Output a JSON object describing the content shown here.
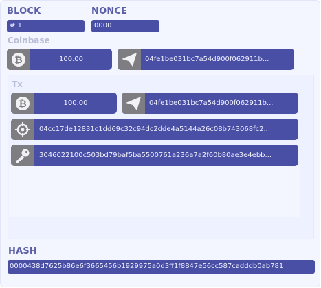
{
  "block": {
    "label": "BLOCK",
    "prefix": "#",
    "value": "1"
  },
  "nonce": {
    "label": "NONCE",
    "value": "0000"
  },
  "coinbase": {
    "label": "Coinbase",
    "amount": "100.00",
    "recipient": "04fe1be031bc7a54d900f062911b..."
  },
  "tx": {
    "label": "Tx",
    "amount": "100.00",
    "recipient": "04fe1be031bc7a54d900f062911b...",
    "sender": "04cc17de12831c1dd69c32c94dc2dde4a5144a26c08b743068fc2...",
    "signature": "3046022100c503bd79baf5ba5500761a236a7a2f60b80ae3e4ebb..."
  },
  "hash": {
    "label": "HASH",
    "value": "0000438d7625b86e6f3665456b1929975a0d3ff1f8847e56cc587cadddb0ab781"
  },
  "icons": {
    "coin": "bitcoin-icon",
    "send": "paper-plane-icon",
    "target": "crosshair-icon",
    "key": "key-icon"
  },
  "colors": {
    "accent": "#4a4fa6",
    "icon_bg": "#7d7d82",
    "label": "#5a5fa8"
  }
}
